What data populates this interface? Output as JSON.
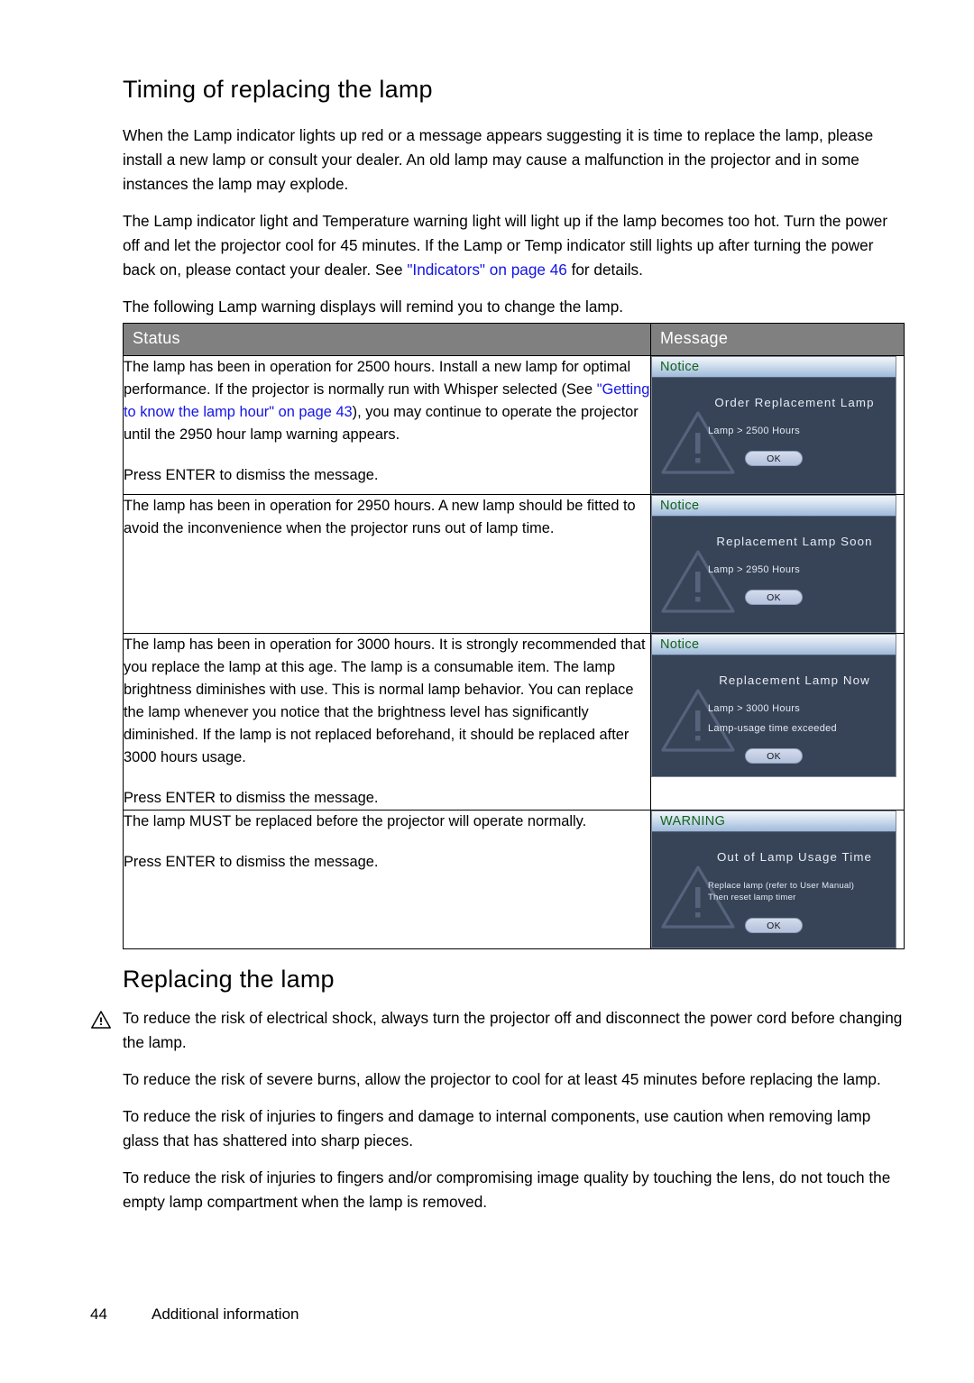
{
  "document": {
    "section1_title": "Timing of replacing the lamp",
    "section1_paragraphs": [
      {
        "parts": [
          {
            "type": "text",
            "value": "When the Lamp indicator lights up red or a message appears suggesting it is time to replace the lamp, please install a new lamp or consult your dealer. An old lamp may cause a malfunction in the projector and in some instances the lamp may explode."
          }
        ]
      },
      {
        "parts": [
          {
            "type": "text",
            "value": "The Lamp indicator light and Temperature warning light will light up if the lamp becomes too hot. Turn the power off and let the projector cool for 45 minutes. If the Lamp or Temp indicator still lights up after turning the power back on, please contact your dealer. See "
          },
          {
            "type": "link",
            "value": "\"Indicators\" on page 46"
          },
          {
            "type": "text",
            "value": " for details."
          }
        ]
      },
      {
        "parts": [
          {
            "type": "text",
            "value": "The following Lamp warning displays will remind you to change the lamp."
          }
        ]
      }
    ],
    "table": {
      "headers": {
        "status": "Status",
        "message": "Message"
      },
      "rows": [
        {
          "status_paragraphs": [
            {
              "parts": [
                {
                  "type": "text",
                  "value": "The lamp has been in operation for 2500 hours. Install a new lamp for optimal performance. If the projector is normally run with Whisper selected (See "
                },
                {
                  "type": "link",
                  "value": "\"Getting to know the lamp hour\" on page 43"
                },
                {
                  "type": "text",
                  "value": "), you may continue to operate the projector until the 2950 hour lamp warning appears."
                }
              ]
            },
            {
              "parts": [
                {
                  "type": "text",
                  "value": "Press ENTER to dismiss the message."
                }
              ]
            }
          ],
          "dialog": {
            "title": "Notice",
            "title_kind": "notice",
            "heading": "Order Replacement Lamp",
            "detail_lines": [
              "Lamp > 2500 Hours"
            ],
            "button_label": "OK",
            "icon": "warning-triangle-watermark"
          }
        },
        {
          "status_paragraphs": [
            {
              "parts": [
                {
                  "type": "text",
                  "value": "The lamp has been in operation for 2950 hours.  A  new lamp should be fitted to avoid the  inconvenience when the projector runs out of  lamp time."
                }
              ]
            }
          ],
          "dialog": {
            "title": "Notice",
            "title_kind": "notice",
            "heading": "Replacement Lamp Soon",
            "detail_lines": [
              "Lamp > 2950 Hours"
            ],
            "button_label": "OK",
            "icon": "warning-triangle-watermark"
          }
        },
        {
          "status_paragraphs": [
            {
              "parts": [
                {
                  "type": "text",
                  "value": "The lamp has been in operation for 3000 hours. It is strongly recommended that you replace the lamp at this age. The lamp is a consumable item. The lamp brightness diminishes with use. This is normal lamp behavior. You can replace the lamp whenever you notice that the brightness level has significantly diminished. If the lamp is not replaced beforehand, it should be replaced after 3000 hours usage."
                }
              ]
            },
            {
              "parts": [
                {
                  "type": "text",
                  "value": "Press ENTER to dismiss the message."
                }
              ]
            }
          ],
          "dialog": {
            "title": "Notice",
            "title_kind": "notice",
            "heading": "Replacement Lamp Now",
            "detail_lines": [
              "Lamp > 3000 Hours",
              "Lamp-usage time exceeded"
            ],
            "button_label": "OK",
            "icon": "warning-triangle-watermark"
          }
        },
        {
          "status_paragraphs": [
            {
              "parts": [
                {
                  "type": "text",
                  "value": "The lamp MUST be replaced before the projector will operate normally."
                }
              ]
            },
            {
              "parts": [
                {
                  "type": "text",
                  "value": "Press ENTER to dismiss the message."
                }
              ]
            }
          ],
          "dialog": {
            "title": "WARNING",
            "title_kind": "warning",
            "heading": "Out of Lamp Usage Time",
            "detail_block": [
              "Replace lamp (refer to User Manual)",
              "Then reset lamp timer"
            ],
            "button_label": "OK",
            "icon": "warning-triangle-watermark"
          }
        }
      ]
    },
    "section2_title": "Replacing the lamp",
    "section2_paragraphs": [
      {
        "has_caution_icon": true,
        "text": "To reduce the risk of electrical shock, always turn the projector off and disconnect the power cord before changing the lamp."
      },
      {
        "has_caution_icon": false,
        "text": "To reduce the risk of severe burns, allow the projector to cool for at least 45 minutes before replacing the lamp."
      },
      {
        "has_caution_icon": false,
        "text": "To reduce the risk of injuries to fingers and damage to internal components, use caution when removing lamp glass that has shattered into sharp pieces."
      },
      {
        "has_caution_icon": false,
        "text": "To reduce the risk of injuries to fingers and/or compromising image quality by touching the lens, do not touch the empty lamp compartment when the lamp is removed."
      }
    ],
    "footer": {
      "page_number": "44",
      "chapter": "Additional information"
    },
    "colors": {
      "link": "#1414e6",
      "table_header_bg": "#808080",
      "osd_body_bg": "#374357",
      "osd_title_text": "#13621f",
      "page_bg": "#ffffff"
    }
  }
}
